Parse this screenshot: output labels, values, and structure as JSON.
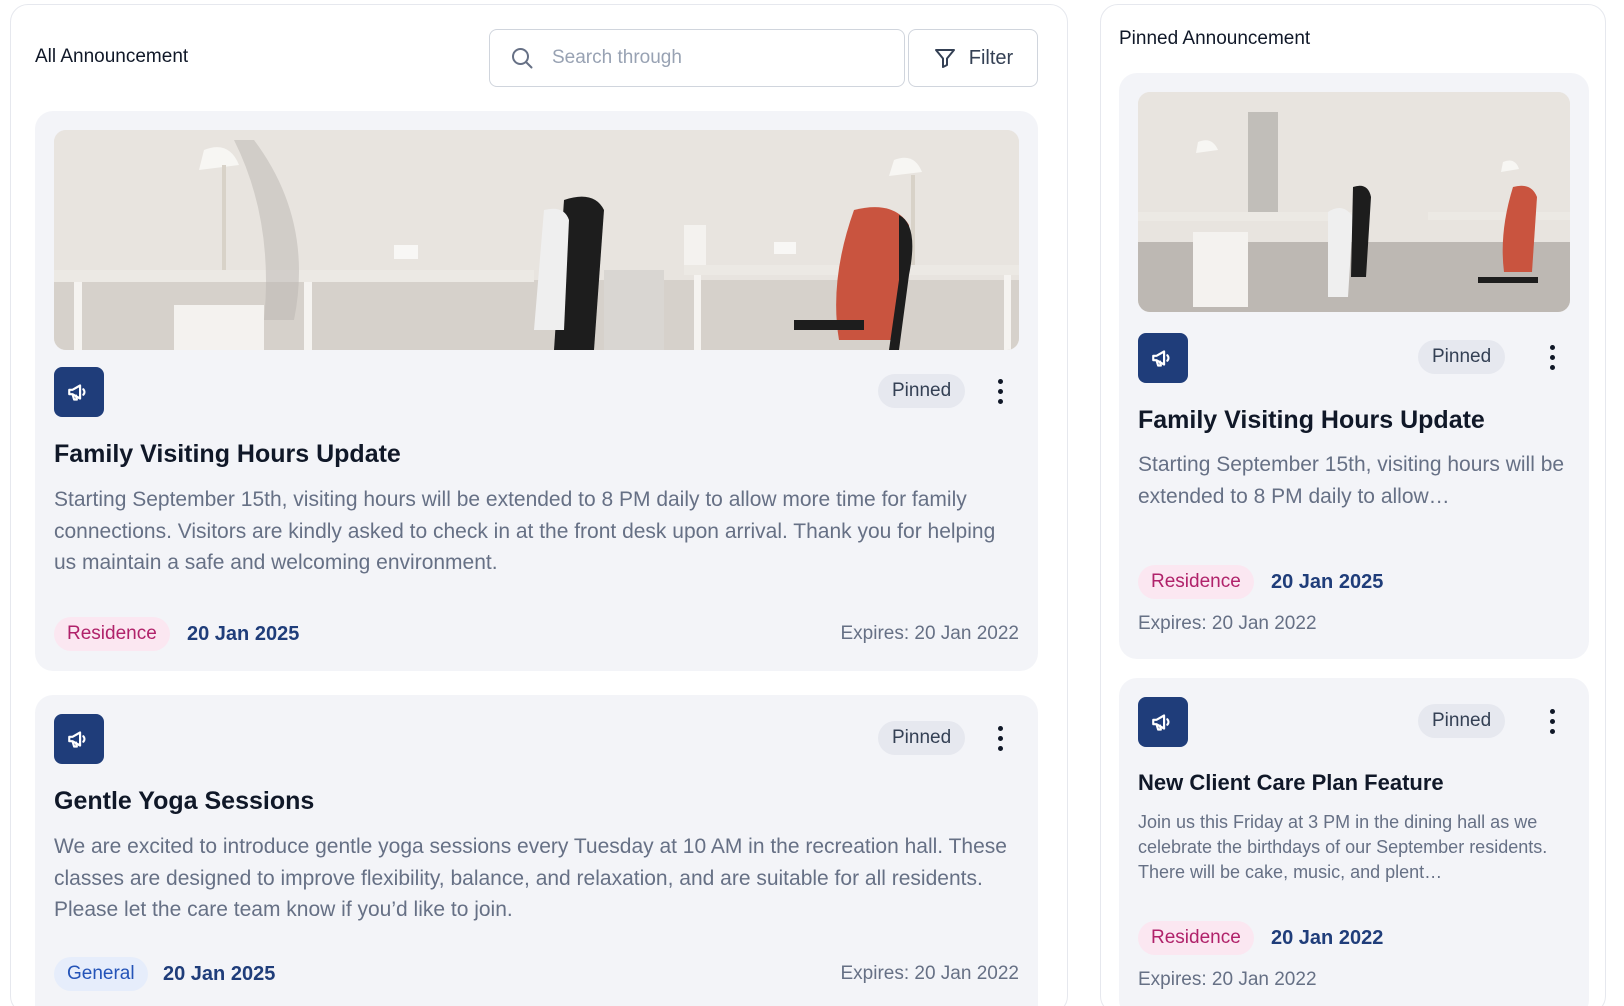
{
  "left_panel": {
    "title": "All Announcement",
    "search_placeholder": "Search through",
    "filter_label": "Filter"
  },
  "right_panel": {
    "title": "Pinned Announcement"
  },
  "announcements": [
    {
      "badge": "Pinned",
      "title": "Family Visiting Hours Update",
      "body": "Starting September 15th, visiting hours will be extended to 8 PM daily to allow more time for family connections. Visitors are kindly asked to check in at the front desk upon arrival. Thank you for helping us maintain a safe and welcoming environment.",
      "tag": "Residence",
      "date": "20 Jan 2025",
      "expires": "Expires: 20 Jan 2022"
    },
    {
      "badge": "Pinned",
      "title": "Gentle Yoga Sessions",
      "body": "We are excited to introduce gentle yoga sessions every Tuesday at 10 AM in the recreation hall. These classes are designed to improve flexibility, balance, and relaxation, and are suitable for all residents. Please let the care team know if you’d like to join.",
      "tag": "General",
      "date": "20 Jan 2025",
      "expires": "Expires: 20 Jan 2022"
    }
  ],
  "pinned": [
    {
      "badge": "Pinned",
      "title": "Family Visiting Hours Update",
      "body": "Starting September 15th, visiting hours will be extended to 8 PM daily to allow…",
      "tag": "Residence",
      "date": "20 Jan 2025",
      "expires": "Expires: 20 Jan 2022"
    },
    {
      "badge": "Pinned",
      "title": "New Client Care Plan Feature",
      "body": "Join us this Friday at 3 PM in the dining hall as we celebrate the birthdays of our September residents. There will be cake, music, and plent…",
      "tag": "Residence",
      "date": "20 Jan 2022",
      "expires": "Expires: 20 Jan 2022"
    }
  ],
  "colors": {
    "icon_tile": "#1f3d7a",
    "date_text": "#1f3d7a",
    "residence_tag_bg": "#fbe7f1",
    "residence_tag_text": "#b0226a",
    "general_tag_bg": "#e6edfb",
    "general_tag_text": "#2454b8",
    "card_bg": "#f3f4f8"
  },
  "icons": {
    "search": "search-icon",
    "filter": "filter-icon",
    "announcement": "megaphone-icon",
    "more": "kebab-menu-icon"
  }
}
